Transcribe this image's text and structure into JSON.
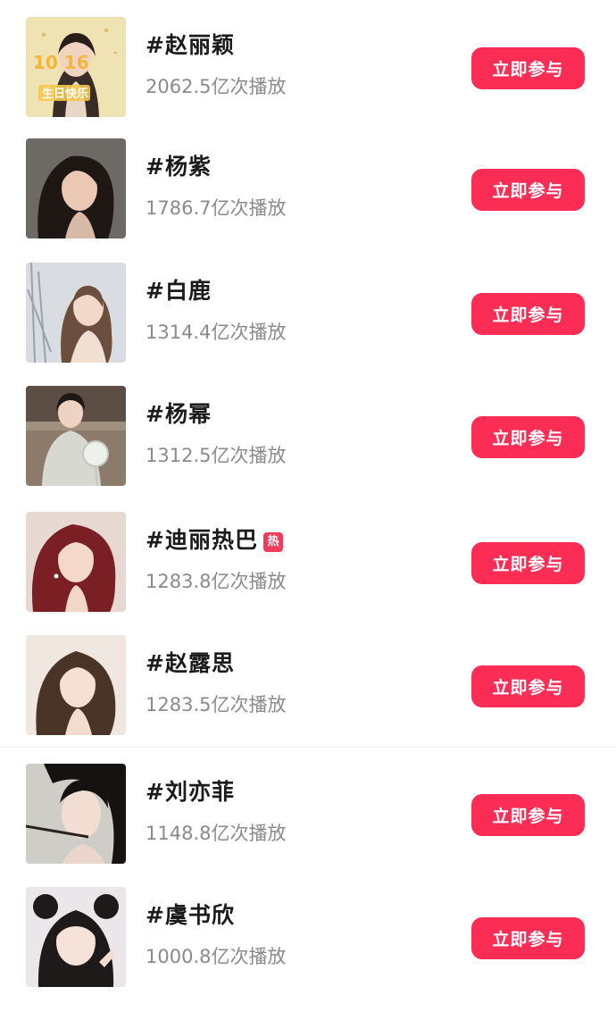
{
  "topics": [
    {
      "title": "#赵丽颖",
      "plays": "2062.5亿次播放",
      "button": "立即参与",
      "hot": false,
      "thumb": {
        "overlay_text": "生日快乐",
        "overlay_text2": "10 16"
      }
    },
    {
      "title": "#杨紫",
      "plays": "1786.7亿次播放",
      "button": "立即参与",
      "hot": false
    },
    {
      "title": "#白鹿",
      "plays": "1314.4亿次播放",
      "button": "立即参与",
      "hot": false
    },
    {
      "title": "#杨幂",
      "plays": "1312.5亿次播放",
      "button": "立即参与",
      "hot": false
    },
    {
      "title": "#迪丽热巴",
      "plays": "1283.8亿次播放",
      "button": "立即参与",
      "hot": true,
      "hot_label": "热"
    },
    {
      "title": "#赵露思",
      "plays": "1283.5亿次播放",
      "button": "立即参与",
      "hot": false
    },
    {
      "title": "#刘亦菲",
      "plays": "1148.8亿次播放",
      "button": "立即参与",
      "hot": false
    },
    {
      "title": "#虞书欣",
      "plays": "1000.8亿次播放",
      "button": "立即参与",
      "hot": false
    }
  ],
  "colors": {
    "button_bg": "#fc2d55",
    "hot_badge": "#f03b5a",
    "title_text": "#1b1b1b",
    "sub_text": "#8a8a8a"
  }
}
